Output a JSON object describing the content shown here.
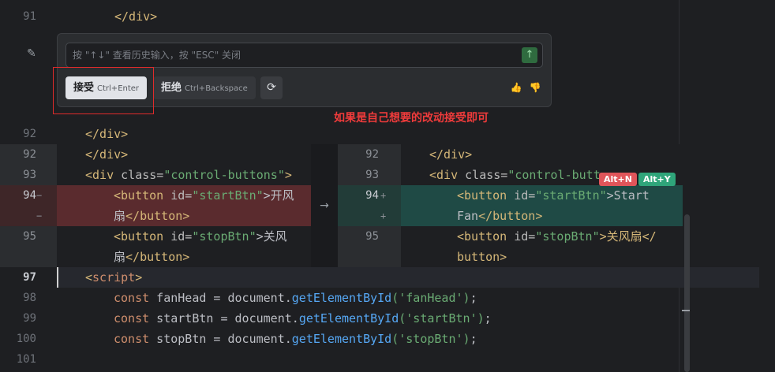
{
  "editor": {
    "top_lines": [
      {
        "num": "91",
        "code": "</div>"
      }
    ],
    "line_92_top": {
      "num": "92",
      "code": "</div>"
    },
    "after_lines": [
      {
        "num": "97",
        "indent": "",
        "parts": [
          "<",
          "script",
          ">"
        ]
      },
      {
        "num": "98"
      },
      {
        "num": "99"
      },
      {
        "num": "100"
      },
      {
        "num": "101"
      }
    ],
    "js_98": {
      "kw": "const",
      "name": " fanHead",
      "eq": " = ",
      "obj": "document.",
      "fn": "getElementById",
      "arg": "('fanHead')",
      "end": ";"
    },
    "js_99": {
      "kw": "const",
      "name": " startBtn",
      "eq": " = ",
      "obj": "document.",
      "fn": "getElementById",
      "arg": "('startBtn')",
      "end": ";"
    },
    "js_100": {
      "kw": "const",
      "name": " stopBtn",
      "eq": " = ",
      "obj": "document.",
      "fn": "getElementById",
      "arg": "('stopBtn')",
      "end": ";"
    }
  },
  "diff": {
    "left": {
      "n92": "92",
      "n93": "93",
      "n94": "94",
      "n95": "95",
      "l92": "</div>",
      "l93_tag": "<div",
      "l93_attr": " class=",
      "l93_str": "\"control-buttons\"",
      "l93_end": ">",
      "l94a_tag": "<button",
      "l94a_attr": " id=",
      "l94a_str": "\"startBtn\"",
      "l94a_end": ">开风",
      "l94b_text": "扇",
      "l94b_tag": "</button>",
      "l95a_tag": "<button",
      "l95a_attr": " id=",
      "l95a_str": "\"stopBtn\"",
      "l95a_end": ">关风",
      "l95b_text": "扇",
      "l95b_tag": "</button>"
    },
    "right": {
      "n92": "92",
      "n93": "93",
      "n94": "94",
      "n95": "95",
      "l92": "</div>",
      "l93_tag": "<div",
      "l93_attr": " class=",
      "l93_str": "\"control-butt",
      "l93_end": "",
      "l94a_tag": "<button",
      "l94a_attr": " id=",
      "l94a_str": "\"startBtn\"",
      "l94a_end": ">Start",
      "l94b_text": "Fan",
      "l94b_tag": "</button>",
      "l95a_tag": "<button",
      "l95a_attr": " id=",
      "l95a_str": "\"stopBtn\"",
      "l95a_end": ">关风扇</",
      "l95b_tag": "button>"
    },
    "arrow": "→",
    "minus": "−",
    "plus": "+",
    "badge_reject": "Alt+N",
    "badge_accept": "Alt+Y"
  },
  "popup": {
    "placeholder": "按 \"↑↓\" 查看历史输入，按 \"ESC\" 关闭",
    "send_icon": "↑",
    "accept_label": "接受",
    "accept_kbd": "Ctrl+Enter",
    "reject_label": "拒绝",
    "reject_kbd": "Ctrl+Backspace",
    "refresh_icon": "⟳",
    "thumb_up": "👍",
    "thumb_down": "👎",
    "wand_icon": "✎"
  },
  "annotation": {
    "text": "如果是自己想要的改动接受即可"
  },
  "colors": {
    "accent_red": "#ef3b3b",
    "deleted_bg": "#5a2b2e",
    "inserted_bg": "#1f4a45"
  }
}
